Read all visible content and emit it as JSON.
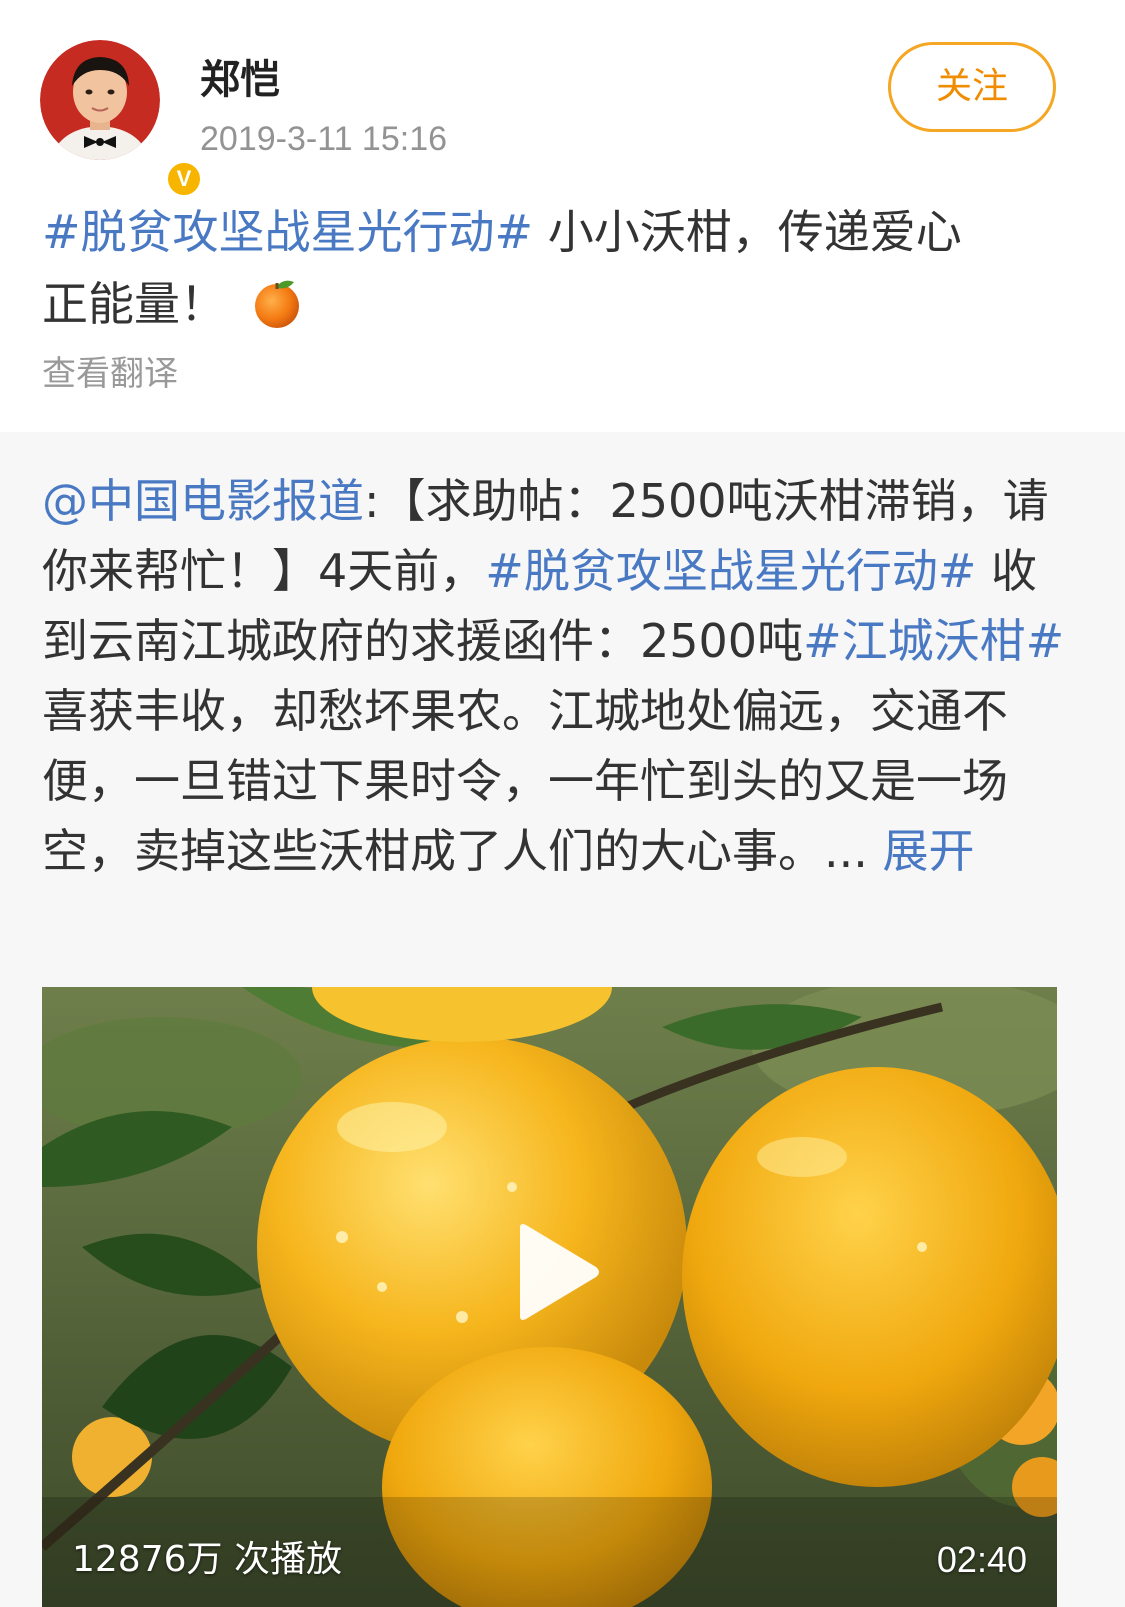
{
  "author": {
    "name": "郑恺",
    "timestamp": "2019-3-11 15:16",
    "verified_mark": "V",
    "avatar_icon": "user-avatar-icon"
  },
  "follow_button": {
    "label": "关注"
  },
  "post": {
    "hashtag": "#脱贫攻坚战星光行动#",
    "text_line1": " 小小沃柑，传递爱心",
    "text_line2": "正能量！",
    "emoji": "orange-emoji",
    "translate_label": "查看翻译"
  },
  "repost": {
    "mention": "@中国电影报道",
    "part1": ":【求助帖：2500吨沃柑滞销，请你来帮忙！】4天前，",
    "hashtag1": "#脱贫攻坚战星光行动#",
    "part2": " 收到云南江城政府的求援函件：2500吨",
    "hashtag2": "#江城沃柑#",
    "part3": "喜获丰收，却愁坏果农。江城地处偏远，交通不便，一旦错过下果时令，一年忙到头的又是一场空，卖掉这些沃柑成了人们的大心事。... ",
    "expand_label": "展开"
  },
  "video": {
    "play_count": "12876万 次播放",
    "duration": "02:40",
    "play_icon": "play-icon"
  },
  "colors": {
    "link_blue": "#4a79c4",
    "follow_orange": "#f5a623",
    "repost_bg": "#f7f7f7",
    "meta_gray": "#939393"
  }
}
